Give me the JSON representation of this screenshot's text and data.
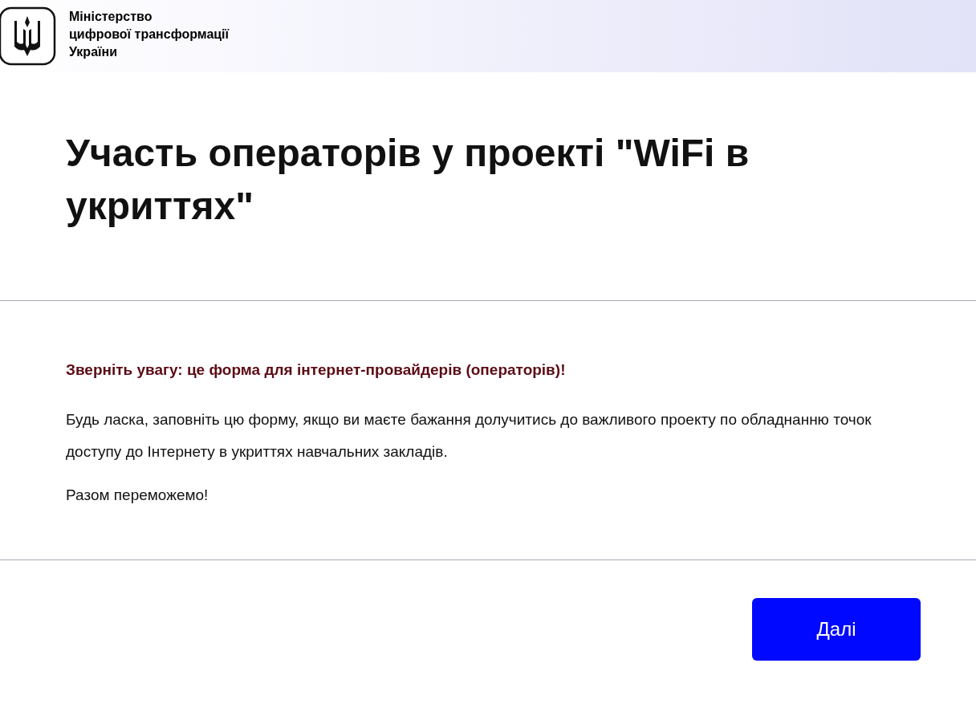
{
  "header": {
    "org_name_lines": [
      "Міністерство",
      "цифрової трансформації",
      "України"
    ]
  },
  "title": "Участь операторів у проекті \"WiFi в укриттях\"",
  "notice": "Зверніть увагу: це форма для інтернет-провайдерів (операторів)!",
  "description": "Будь ласка, заповніть цю форму, якщо ви маєте бажання долучитись до важливого проекту по обладнанню точок доступу до Інтернету в укриттях навчальних закладів.",
  "closing": "Разом переможемо!",
  "buttons": [
    {
      "label": "Далі"
    }
  ]
}
